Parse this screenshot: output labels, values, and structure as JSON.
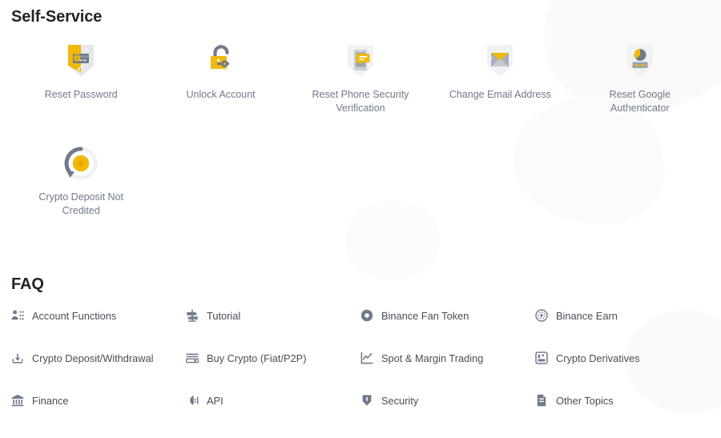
{
  "theme": {
    "brand_yellow": "#F0B90B",
    "icon_gray": "#707A8A",
    "heading_color": "#1E2329",
    "label_color": "#707A8A",
    "faq_label_color": "#474D57",
    "background": "#FFFFFF"
  },
  "self_service": {
    "title": "Self-Service",
    "items": [
      {
        "label": "Reset Password",
        "icon": "shield-card-lock-icon"
      },
      {
        "label": "Unlock Account",
        "icon": "unlocked-padlock-key-icon"
      },
      {
        "label": "Reset Phone Security Verification",
        "icon": "shield-phone-message-icon"
      },
      {
        "label": "Change Email Address",
        "icon": "shield-envelope-icon"
      },
      {
        "label": "Reset Google Authenticator",
        "icon": "shield-pie-authenticator-icon"
      },
      {
        "label": "Crypto Deposit Not Credited",
        "icon": "refresh-coin-icon"
      }
    ]
  },
  "faq": {
    "title": "FAQ",
    "items": [
      {
        "label": "Account Functions",
        "icon": "user-list-icon"
      },
      {
        "label": "Tutorial",
        "icon": "signpost-icon"
      },
      {
        "label": "Binance Fan Token",
        "icon": "filled-circle-token-icon"
      },
      {
        "label": "Binance Earn",
        "icon": "dotted-circle-earn-icon"
      },
      {
        "label": "Crypto Deposit/Withdrawal",
        "icon": "deposit-withdraw-arrow-icon"
      },
      {
        "label": "Buy Crypto (Fiat/P2P)",
        "icon": "banknote-icon"
      },
      {
        "label": "Spot & Margin Trading",
        "icon": "line-chart-icon"
      },
      {
        "label": "Crypto Derivatives",
        "icon": "bar-chart-box-icon"
      },
      {
        "label": "Finance",
        "icon": "bank-icon"
      },
      {
        "label": "API",
        "icon": "plug-icon"
      },
      {
        "label": "Security",
        "icon": "shield-icon"
      },
      {
        "label": "Other Topics",
        "icon": "document-icon"
      }
    ]
  }
}
